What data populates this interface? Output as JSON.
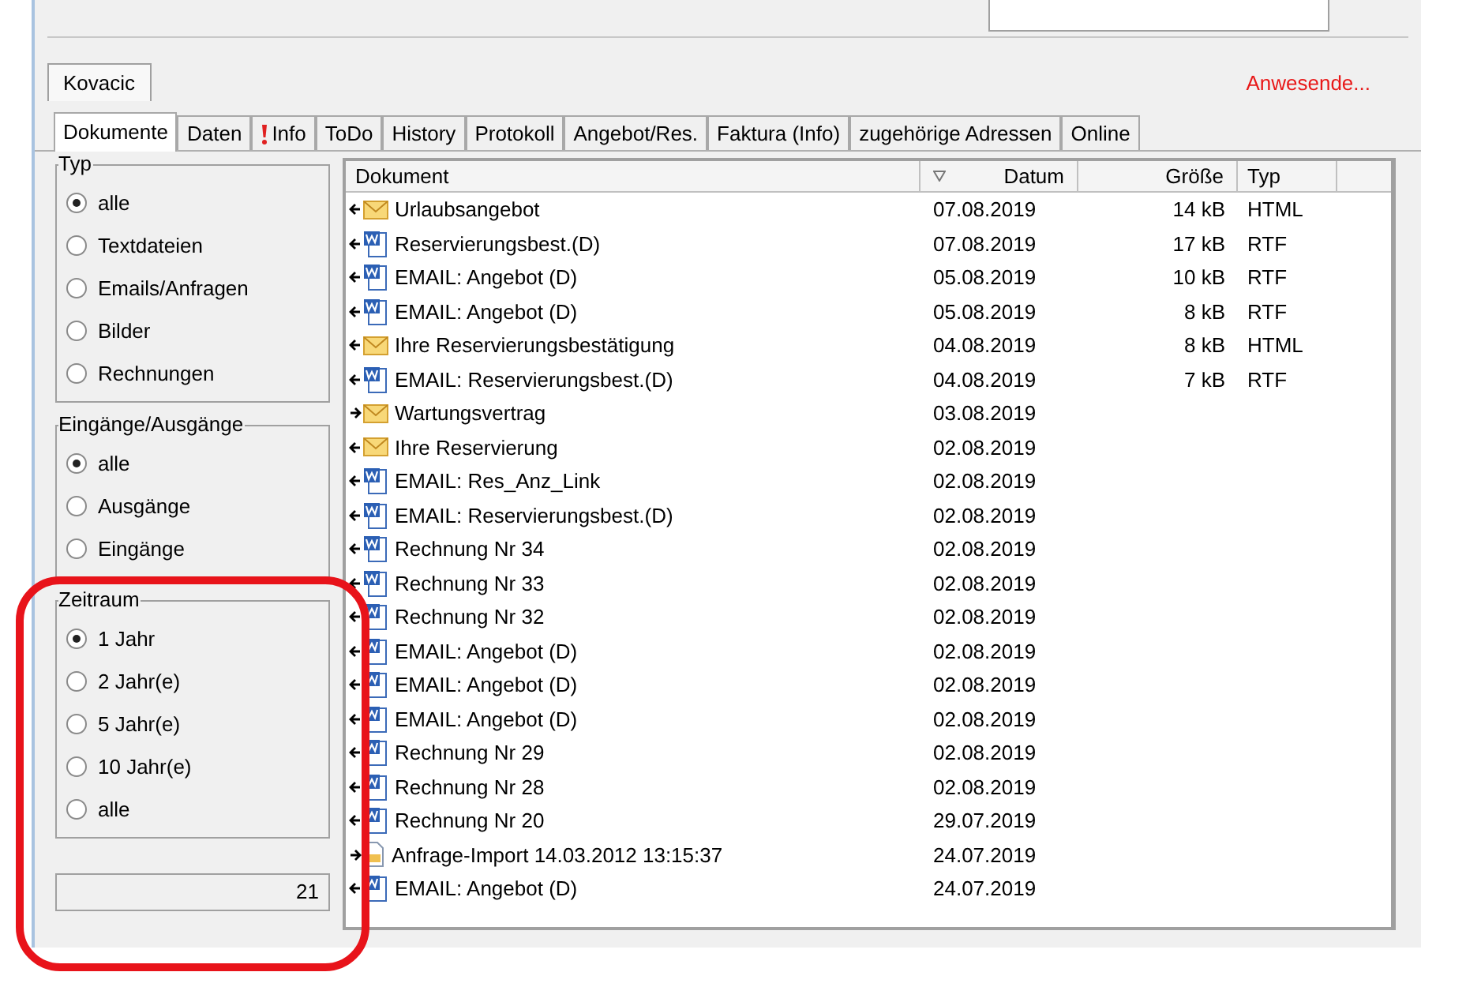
{
  "record_tab": {
    "label": "Kovacic",
    "selected": true
  },
  "present_link": "Anwesende...",
  "tabs": [
    {
      "label": "Dokumente",
      "selected": true,
      "kind": "plain"
    },
    {
      "label": "Daten",
      "selected": false,
      "kind": "plain"
    },
    {
      "label": "Info",
      "selected": false,
      "kind": "alert"
    },
    {
      "label": "ToDo",
      "selected": false,
      "kind": "plain"
    },
    {
      "label": "History",
      "selected": false,
      "kind": "plain"
    },
    {
      "label": "Protokoll",
      "selected": false,
      "kind": "plain"
    },
    {
      "label": "Angebot/Res.",
      "selected": false,
      "kind": "plain"
    },
    {
      "label": "Faktura (Info)",
      "selected": false,
      "kind": "plain"
    },
    {
      "label": "zugehörige Adressen",
      "selected": false,
      "kind": "plain"
    },
    {
      "label": "Online",
      "selected": false,
      "kind": "plain"
    }
  ],
  "filter_groups": [
    {
      "title": "Typ",
      "options": [
        {
          "label": "alle",
          "selected": true
        },
        {
          "label": "Textdateien",
          "selected": false
        },
        {
          "label": "Emails/Anfragen",
          "selected": false
        },
        {
          "label": "Bilder",
          "selected": false
        },
        {
          "label": "Rechnungen",
          "selected": false
        }
      ]
    },
    {
      "title": "Eingänge/Ausgänge",
      "options": [
        {
          "label": "alle",
          "selected": true
        },
        {
          "label": "Ausgänge",
          "selected": false
        },
        {
          "label": "Eingänge",
          "selected": false
        }
      ]
    },
    {
      "title": "Zeitraum",
      "options": [
        {
          "label": "1 Jahr",
          "selected": true
        },
        {
          "label": "2 Jahr(e)",
          "selected": false
        },
        {
          "label": "5 Jahr(e)",
          "selected": false
        },
        {
          "label": "10 Jahr(e)",
          "selected": false
        },
        {
          "label": "alle",
          "selected": false
        }
      ]
    }
  ],
  "count": "21",
  "highlight": {
    "color": "#e8131a"
  },
  "table": {
    "columns": [
      "Dokument",
      "Datum",
      "Größe",
      "Typ"
    ],
    "rows": [
      {
        "incoming": true,
        "kind": "mail",
        "name": "Urlaubsangebot",
        "date": "07.08.2019",
        "size": "14 kB",
        "type": "HTML"
      },
      {
        "incoming": true,
        "kind": "doc",
        "name": "Reservierungsbest.(D)",
        "date": "07.08.2019",
        "size": "17 kB",
        "type": "RTF"
      },
      {
        "incoming": true,
        "kind": "doc",
        "name": "EMAIL: Angebot (D)",
        "date": "05.08.2019",
        "size": "10 kB",
        "type": "RTF"
      },
      {
        "incoming": true,
        "kind": "doc",
        "name": "EMAIL: Angebot (D)",
        "date": "05.08.2019",
        "size": "8 kB",
        "type": "RTF"
      },
      {
        "incoming": true,
        "kind": "mail",
        "name": "Ihre Reservierungsbestätigung",
        "date": "04.08.2019",
        "size": "8 kB",
        "type": "HTML"
      },
      {
        "incoming": true,
        "kind": "doc",
        "name": "EMAIL: Reservierungsbest.(D)",
        "date": "04.08.2019",
        "size": "7 kB",
        "type": "RTF"
      },
      {
        "incoming": false,
        "kind": "mail",
        "name": "Wartungsvertrag",
        "date": "03.08.2019"
      },
      {
        "incoming": true,
        "kind": "mail",
        "name": "Ihre Reservierung",
        "date": "02.08.2019"
      },
      {
        "incoming": true,
        "kind": "doc",
        "name": "EMAIL: Res_Anz_Link",
        "date": "02.08.2019"
      },
      {
        "incoming": true,
        "kind": "doc",
        "name": "EMAIL: Reservierungsbest.(D)",
        "date": "02.08.2019"
      },
      {
        "incoming": true,
        "kind": "doc",
        "name": "Rechnung Nr 34",
        "date": "02.08.2019"
      },
      {
        "incoming": true,
        "kind": "doc",
        "name": "Rechnung Nr 33",
        "date": "02.08.2019"
      },
      {
        "incoming": true,
        "kind": "doc",
        "name": "Rechnung Nr 32",
        "date": "02.08.2019"
      },
      {
        "incoming": true,
        "kind": "doc",
        "name": "EMAIL: Angebot (D)",
        "date": "02.08.2019"
      },
      {
        "incoming": true,
        "kind": "doc",
        "name": "EMAIL: Angebot (D)",
        "date": "02.08.2019"
      },
      {
        "incoming": true,
        "kind": "doc",
        "name": "EMAIL: Angebot (D)",
        "date": "02.08.2019"
      },
      {
        "incoming": true,
        "kind": "doc",
        "name": "Rechnung Nr 29",
        "date": "02.08.2019"
      },
      {
        "incoming": true,
        "kind": "doc",
        "name": "Rechnung Nr 28",
        "date": "02.08.2019"
      },
      {
        "incoming": true,
        "kind": "doc",
        "name": "Rechnung Nr 20",
        "date": "29.07.2019"
      },
      {
        "incoming": false,
        "kind": "import",
        "name": "Anfrage-Import 14.03.2012 13:15:37",
        "date": "24.07.2019"
      },
      {
        "incoming": true,
        "kind": "doc",
        "name": "EMAIL: Angebot (D)",
        "date": "24.07.2019"
      }
    ]
  }
}
